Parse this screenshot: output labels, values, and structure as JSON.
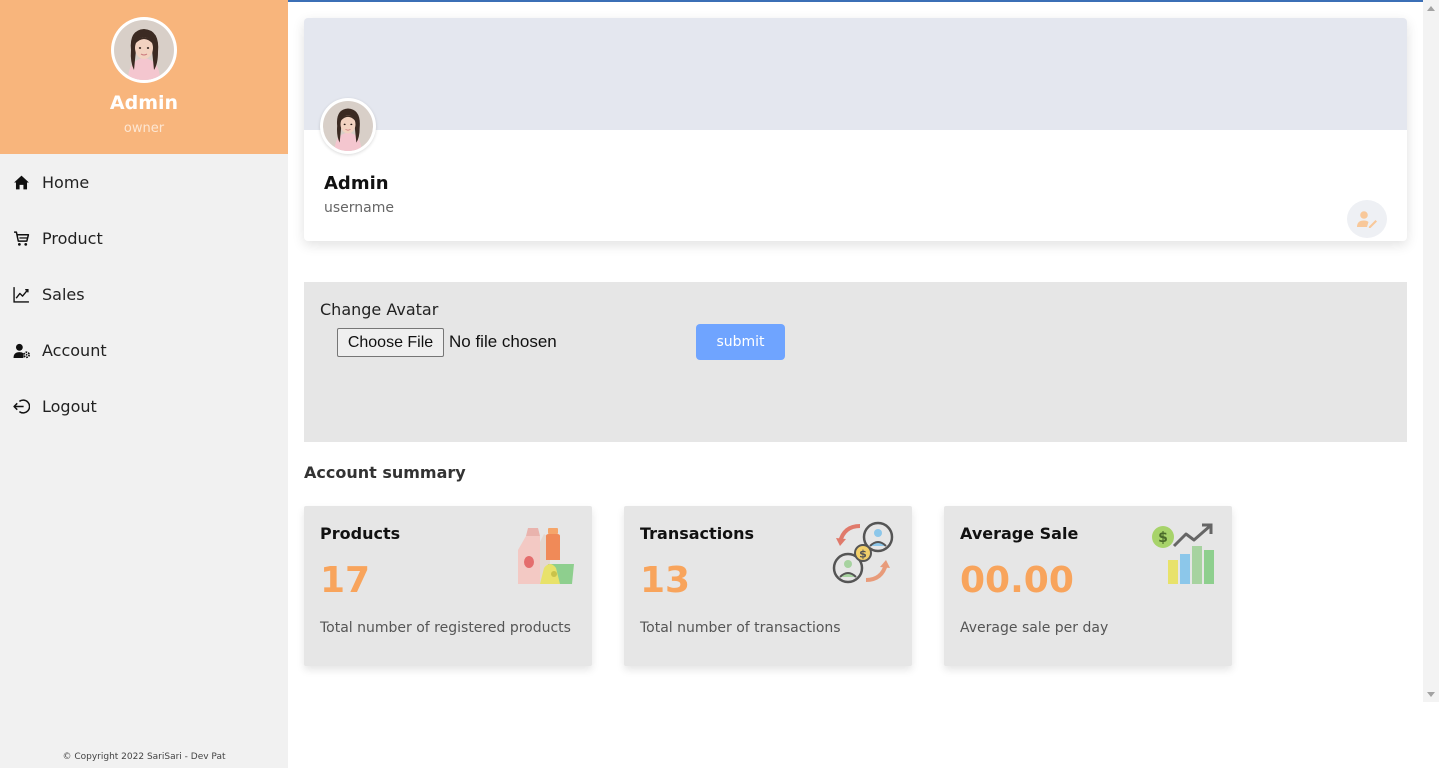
{
  "colors": {
    "brand": "#f8b57c",
    "accent": "#f8a45c",
    "button": "#6fa4ff",
    "sidebar_bg": "#f1f1f1",
    "panel_bg": "#e6e6e6"
  },
  "sidebar": {
    "user": {
      "name": "Admin",
      "role": "owner",
      "avatar": "profile-photo"
    },
    "items": [
      {
        "label": "Home",
        "icon": "home-icon"
      },
      {
        "label": "Product",
        "icon": "cart-icon"
      },
      {
        "label": "Sales",
        "icon": "chart-line-icon"
      },
      {
        "label": "Account",
        "icon": "user-gear-icon"
      },
      {
        "label": "Logout",
        "icon": "logout-icon"
      }
    ],
    "copyright": "© Copyright 2022 SariSari - Dev Pat"
  },
  "profile": {
    "name": "Admin",
    "username": "username",
    "edit_icon": "user-edit-icon"
  },
  "avatar_form": {
    "title": "Change Avatar",
    "file_button": "Choose File",
    "file_status": "No file chosen",
    "submit_label": "submit"
  },
  "summary": {
    "title": "Account summary",
    "cards": [
      {
        "title": "Products",
        "value": "17",
        "description": "Total number of registered products",
        "icon": "groceries-icon"
      },
      {
        "title": "Transactions",
        "value": "13",
        "description": "Total number of transactions",
        "icon": "money-exchange-icon"
      },
      {
        "title": "Average Sale",
        "value": "00.00",
        "description": "Average sale per day",
        "icon": "sales-growth-icon"
      }
    ]
  }
}
